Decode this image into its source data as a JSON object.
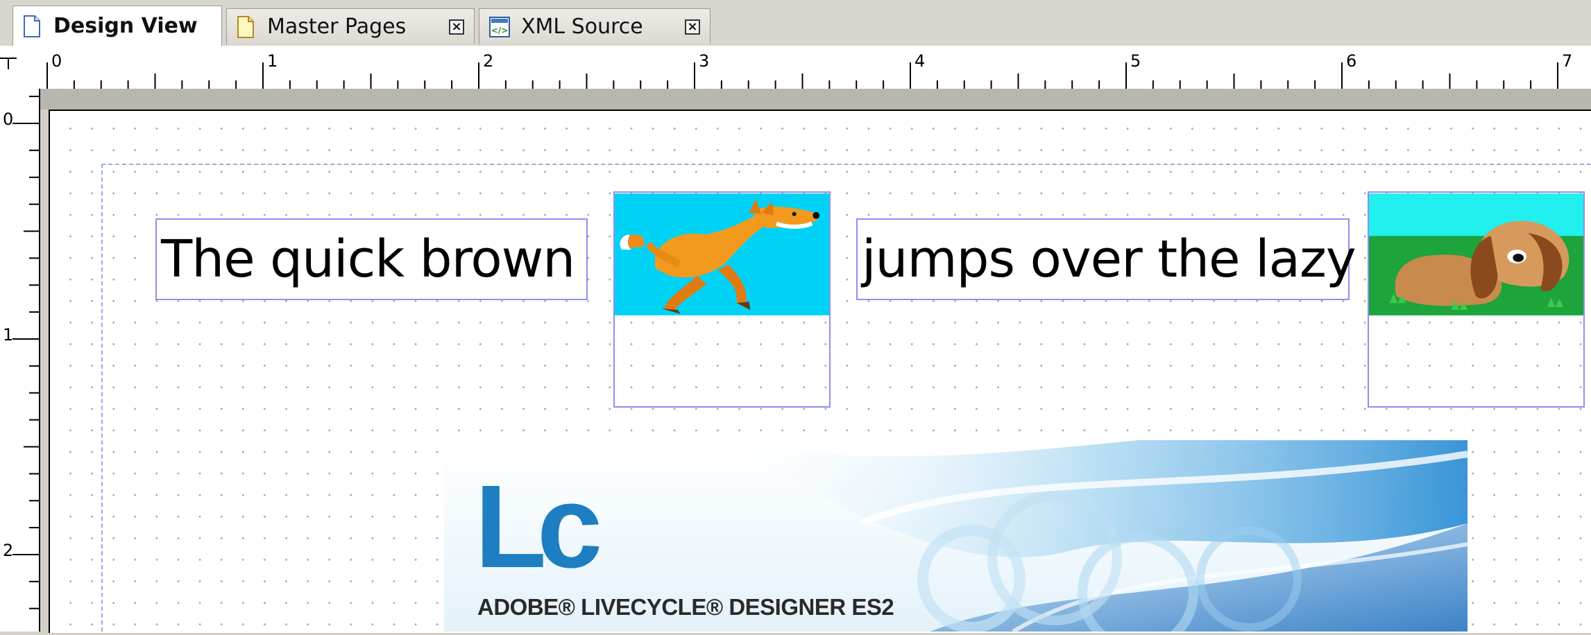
{
  "tabs": [
    {
      "label": "Design View",
      "icon": "document-icon",
      "active": true
    },
    {
      "label": "Master Pages",
      "icon": "document-icon",
      "active": false
    },
    {
      "label": "XML Source",
      "icon": "xml-source-icon",
      "active": false
    }
  ],
  "ruler": {
    "horizontal_marks": [
      "0",
      "1",
      "2",
      "3",
      "4",
      "5",
      "6",
      "7"
    ],
    "vertical_marks": [
      "0",
      "1",
      "2"
    ]
  },
  "form": {
    "text1": "The quick brown",
    "text2": "jumps over the lazy"
  },
  "splash": {
    "logo": "Lc",
    "product": "ADOBE® LIVECYCLE® DESIGNER ES2"
  },
  "colors": {
    "field_border": "#8f8ff0",
    "margin_guide": "#9da6f2",
    "logo_blue": "#1d7fc2",
    "fox_sky": "#00d2f5",
    "dog_sky": "#22f0ee",
    "dog_grass": "#1da43a"
  }
}
